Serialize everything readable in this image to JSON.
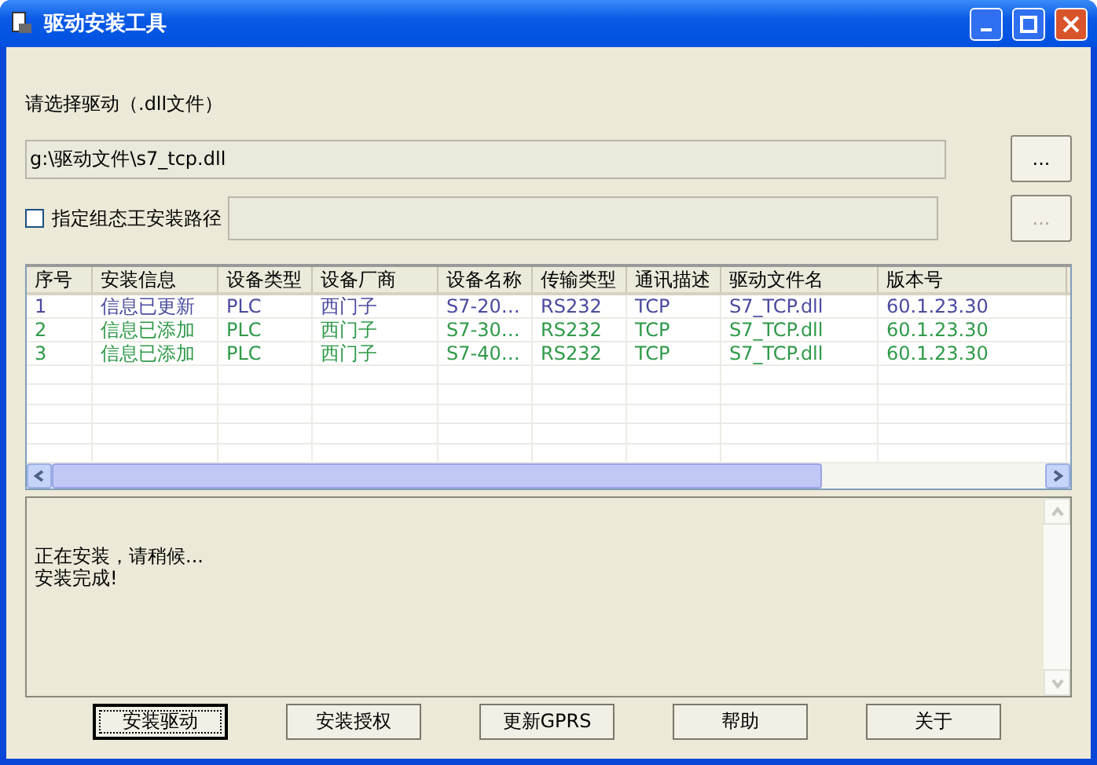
{
  "window": {
    "title": "驱动安装工具"
  },
  "driver_label": "请选择驱动（.dll文件）",
  "driver_path": {
    "value": "g:\\驱动文件\\s7_tcp.dll",
    "browse": "...",
    "disabled": false
  },
  "install_path": {
    "label": "指定组态王安装路径",
    "checked": false,
    "browse": "...",
    "disabled": true
  },
  "table": {
    "columns": [
      "序号",
      "安装信息",
      "设备类型",
      "设备厂商",
      "设备名称",
      "传输类型",
      "通讯描述",
      "驱动文件名",
      "版本号"
    ],
    "rows": [
      {
        "color": "#4a4aa0",
        "cells": [
          "1",
          "信息已更新",
          "PLC",
          "西门子",
          "S7-20…",
          "RS232",
          "TCP",
          "S7_TCP.dll",
          "60.1.23.30"
        ]
      },
      {
        "color": "#2f9a48",
        "cells": [
          "2",
          "信息已添加",
          "PLC",
          "西门子",
          "S7-30…",
          "RS232",
          "TCP",
          "S7_TCP.dll",
          "60.1.23.30"
        ]
      },
      {
        "color": "#2f9a48",
        "cells": [
          "3",
          "信息已添加",
          "PLC",
          "西门子",
          "S7-40…",
          "RS232",
          "TCP",
          "S7_TCP.dll",
          "60.1.23.30"
        ]
      }
    ]
  },
  "log": [
    "正在安装，请稍候...",
    "安装完成!"
  ],
  "buttons": [
    {
      "label": "安装驱动",
      "focused": true
    },
    {
      "label": "安装授权",
      "focused": false
    },
    {
      "label": "更新GPRS",
      "focused": false
    },
    {
      "label": "帮助",
      "focused": false
    },
    {
      "label": "关于",
      "focused": false
    }
  ]
}
